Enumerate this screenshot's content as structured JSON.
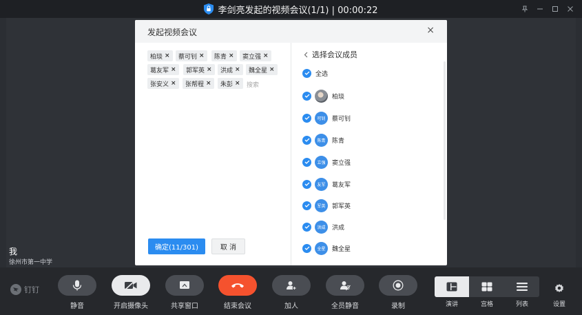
{
  "window": {
    "title": "李剑亮发起的视频会议(1/1) | 00:00:22"
  },
  "self": {
    "name": "我",
    "org": "徐州市第一中学"
  },
  "brand": {
    "name": "钉钉"
  },
  "toolbar": {
    "mute": "静音",
    "camera": "开启摄像头",
    "share": "共享窗口",
    "end": "结束会议",
    "add": "加人",
    "mute_all": "全员静音",
    "record": "录制",
    "layout_speaker": "演讲",
    "layout_grid": "宫格",
    "layout_list": "列表",
    "settings": "设置"
  },
  "dialog": {
    "title": "发起视频会议",
    "close": "×",
    "search_placeholder": "搜索",
    "confirm": "确定(11/301)",
    "cancel": "取 消",
    "selected": [
      "柏琰",
      "蔡可钊",
      "陈青",
      "窦立强",
      "葛友军",
      "郭军英",
      "洪成",
      "魏全星",
      "张安义",
      "张帮程",
      "朱彭"
    ],
    "members_title": "选择会议成员",
    "select_all": "全选",
    "members": [
      {
        "avatar": "",
        "name": "柏琰"
      },
      {
        "avatar": "可钊",
        "name": "蔡可钊"
      },
      {
        "avatar": "陈青",
        "name": "陈青"
      },
      {
        "avatar": "立强",
        "name": "窦立强"
      },
      {
        "avatar": "友军",
        "name": "葛友军"
      },
      {
        "avatar": "军英",
        "name": "郭军英"
      },
      {
        "avatar": "洪成",
        "name": "洪成"
      },
      {
        "avatar": "全星",
        "name": "魏全星"
      }
    ]
  },
  "colors": {
    "accent": "#2b8cf0",
    "end_call": "#f5522e",
    "toolbar_bg": "#26282c"
  }
}
